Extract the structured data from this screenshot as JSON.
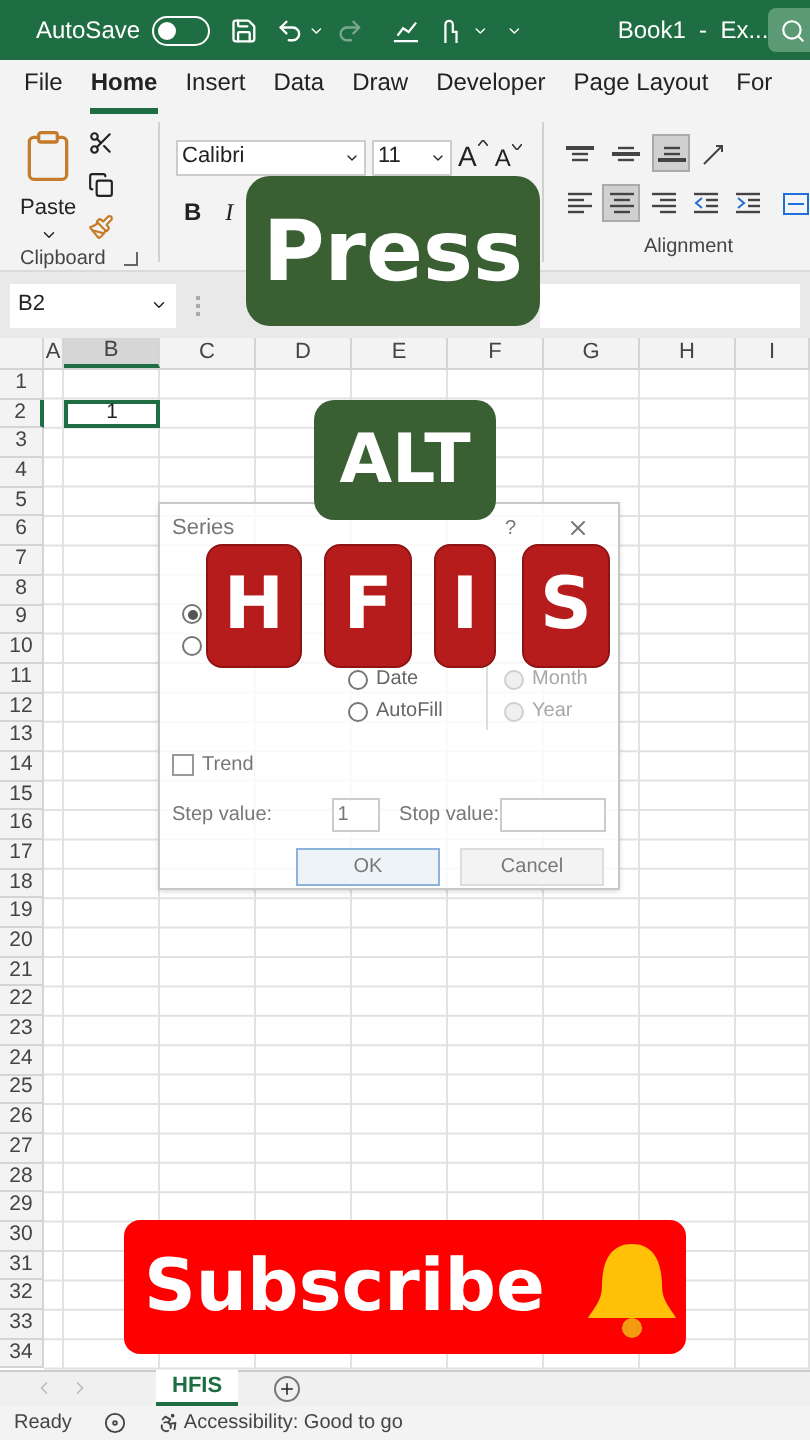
{
  "title_bar": {
    "autosave_label": "AutoSave",
    "autosave_on": false,
    "title": "Book1  -  Ex..."
  },
  "tabs": [
    {
      "label": "File",
      "selected": false
    },
    {
      "label": "Home",
      "selected": true
    },
    {
      "label": "Insert",
      "selected": false
    },
    {
      "label": "Data",
      "selected": false
    },
    {
      "label": "Draw",
      "selected": false
    },
    {
      "label": "Developer",
      "selected": false
    },
    {
      "label": "Page Layout",
      "selected": false
    },
    {
      "label": "For",
      "selected": false
    }
  ],
  "ribbon": {
    "paste_label": "Paste",
    "clipboard_label": "Clipboard",
    "font_name": "Calibri",
    "font_size": "11",
    "font_buttons": [
      {
        "label": "A",
        "kind": "grow"
      },
      {
        "label": "A",
        "kind": "shrink"
      }
    ],
    "style_buttons": [
      {
        "label": "B",
        "kind": "bold"
      },
      {
        "label": "I",
        "kind": "italic"
      }
    ],
    "alignment_label": "Alignment",
    "vertical_align": [
      {
        "kind": "top",
        "selected": false
      },
      {
        "kind": "middle",
        "selected": false
      },
      {
        "kind": "bottom",
        "selected": true
      }
    ],
    "horizontal_align": [
      {
        "kind": "left",
        "selected": false
      },
      {
        "kind": "center",
        "selected": true
      },
      {
        "kind": "right",
        "selected": false
      },
      {
        "kind": "outdent",
        "selected": false
      },
      {
        "kind": "indent",
        "selected": false
      }
    ]
  },
  "name_box": "B2",
  "columns": [
    {
      "label": "A",
      "selected": false
    },
    {
      "label": "B",
      "selected": true
    },
    {
      "label": "C",
      "selected": false
    },
    {
      "label": "D",
      "selected": false
    },
    {
      "label": "E",
      "selected": false
    },
    {
      "label": "F",
      "selected": false
    },
    {
      "label": "G",
      "selected": false
    },
    {
      "label": "H",
      "selected": false
    },
    {
      "label": "I",
      "selected": false
    }
  ],
  "rows": [
    {
      "label": "1",
      "selected": false
    },
    {
      "label": "2",
      "selected": true
    },
    {
      "label": "3",
      "selected": false
    },
    {
      "label": "4",
      "selected": false
    },
    {
      "label": "5",
      "selected": false
    },
    {
      "label": "6",
      "selected": false
    },
    {
      "label": "7",
      "selected": false
    },
    {
      "label": "8",
      "selected": false
    },
    {
      "label": "9",
      "selected": false
    },
    {
      "label": "10",
      "selected": false
    },
    {
      "label": "11",
      "selected": false
    },
    {
      "label": "12",
      "selected": false
    },
    {
      "label": "13",
      "selected": false
    },
    {
      "label": "14",
      "selected": false
    },
    {
      "label": "15",
      "selected": false
    },
    {
      "label": "16",
      "selected": false
    },
    {
      "label": "17",
      "selected": false
    },
    {
      "label": "18",
      "selected": false
    },
    {
      "label": "19",
      "selected": false
    },
    {
      "label": "20",
      "selected": false
    },
    {
      "label": "21",
      "selected": false
    },
    {
      "label": "22",
      "selected": false
    },
    {
      "label": "23",
      "selected": false
    },
    {
      "label": "24",
      "selected": false
    },
    {
      "label": "25",
      "selected": false
    },
    {
      "label": "26",
      "selected": false
    },
    {
      "label": "27",
      "selected": false
    },
    {
      "label": "28",
      "selected": false
    },
    {
      "label": "29",
      "selected": false
    },
    {
      "label": "30",
      "selected": false
    },
    {
      "label": "31",
      "selected": false
    },
    {
      "label": "32",
      "selected": false
    },
    {
      "label": "33",
      "selected": false
    },
    {
      "label": "34",
      "selected": false
    }
  ],
  "cell_b2": "1",
  "dialog": {
    "title": "Series",
    "help": "?",
    "series_in": [
      {
        "selected": true
      },
      {
        "selected": false
      }
    ],
    "type": [
      {
        "label": "Date",
        "selected": false
      },
      {
        "label": "AutoFill",
        "selected": false
      }
    ],
    "date_unit": [
      {
        "label": "Month",
        "disabled": true
      },
      {
        "label": "Year",
        "disabled": true
      }
    ],
    "trend": {
      "label": "Trend",
      "checked": false
    },
    "step_label": "Step value:",
    "step_value": "1",
    "stop_label": "Stop value:",
    "buttons": [
      "OK",
      "Cancel"
    ]
  },
  "overlays": {
    "press": "Press",
    "alt": "ALT",
    "keys": [
      "H",
      "F",
      "I",
      "S"
    ],
    "subscribe": "Subscribe"
  },
  "sheet_tabs": [
    {
      "label": "HFIS",
      "selected": true
    }
  ],
  "status_bar": {
    "ready": "Ready",
    "accessibility": "Accessibility: Good to go"
  }
}
